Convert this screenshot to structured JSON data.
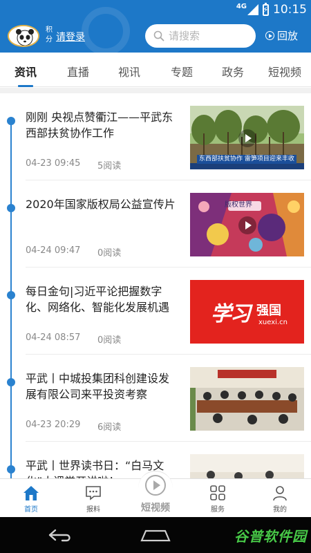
{
  "status_bar": {
    "network": "4G",
    "time": "10:15"
  },
  "header": {
    "credit_label": "积分",
    "login_label": "请登录",
    "search_placeholder": "请搜索",
    "replay_label": "回放"
  },
  "tabs": [
    {
      "label": "资讯",
      "active": true
    },
    {
      "label": "直播",
      "active": false
    },
    {
      "label": "视讯",
      "active": false
    },
    {
      "label": "专题",
      "active": false
    },
    {
      "label": "政务",
      "active": false
    },
    {
      "label": "短视频",
      "active": false
    }
  ],
  "news": [
    {
      "title": "刚刚 央视点赞衢江——平武东西部扶贫协作工作",
      "date": "04-23 09:45",
      "reads": "5阅读",
      "thumb_caption": "东西部扶贫协作 雷笋项目迎来丰收",
      "has_video": true
    },
    {
      "title": "2020年国家版权局公益宣传片",
      "date": "04-24 09:47",
      "reads": "0阅读",
      "thumb_caption": "版权世界",
      "has_video": true
    },
    {
      "title": "每日金句|习近平论把握数字化、网络化、智能化发展机遇",
      "date": "04-24 08:57",
      "reads": "0阅读",
      "thumb_brand": "学习",
      "thumb_brand_sub": "强国",
      "thumb_url": "xuexi.cn",
      "has_video": false
    },
    {
      "title": "平武丨中城投集团科创建设发展有限公司来平投资考察",
      "date": "04-23 20:29",
      "reads": "6阅读",
      "has_video": false
    },
    {
      "title": "平武丨世界读书日：“白马文化”大课堂开讲啦！",
      "date": "",
      "reads": "",
      "has_video": false
    }
  ],
  "bottom_nav": {
    "home": "首页",
    "report": "报料",
    "short_video": "短视频",
    "service": "服务",
    "mine": "我的"
  },
  "watermark": "谷普软件园",
  "colors": {
    "primary": "#1d78c8",
    "timeline": "#2a82cf",
    "xuexi_red": "#e3231e"
  }
}
